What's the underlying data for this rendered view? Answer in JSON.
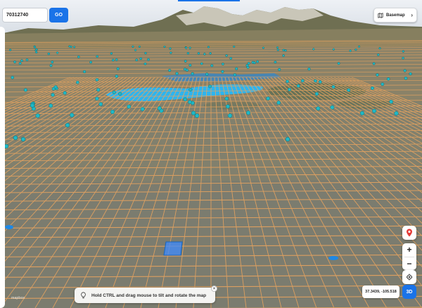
{
  "search": {
    "value": "70312740",
    "go_label": "GO"
  },
  "basemap": {
    "label": "Basemap"
  },
  "map": {
    "lake_label": "",
    "hint_text": "Hold CTRL and drag mouse to tilt and rotate the map",
    "coordinates": "37.3439, -105.518",
    "view_mode_label": "3D",
    "zoom_in_label": "+",
    "zoom_out_label": "−",
    "watermark": "mapbox"
  },
  "colors": {
    "accent": "#1a73e8",
    "parcel_grid": "#e7a35f",
    "lake": "#29b6f6",
    "marker": "#1fb8c6",
    "selected_parcel": "#3d8bff"
  },
  "icons": [
    "map-icon",
    "chevron-right-icon",
    "location-pin-icon",
    "crosshair-icon",
    "lightbulb-icon",
    "close-icon"
  ]
}
